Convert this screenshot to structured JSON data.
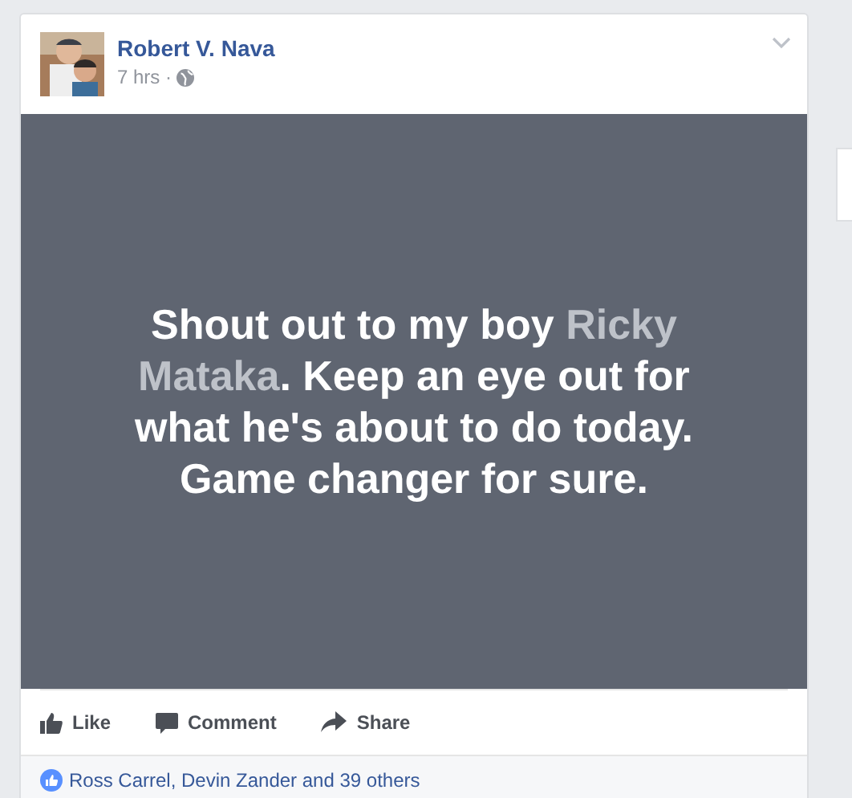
{
  "post": {
    "author": "Robert V. Nava",
    "time": "7 hrs ·",
    "status": {
      "before": "Shout out to my boy ",
      "tag": "Ricky Mataka",
      "after": ". Keep an eye out for what he's about to do today. Game changer for sure."
    },
    "actions": [
      {
        "kind": "like",
        "label": "Like"
      },
      {
        "kind": "comment",
        "label": "Comment"
      },
      {
        "kind": "share",
        "label": "Share"
      }
    ],
    "reactions": "Ross Carrel, Devin Zander and 39 others"
  }
}
